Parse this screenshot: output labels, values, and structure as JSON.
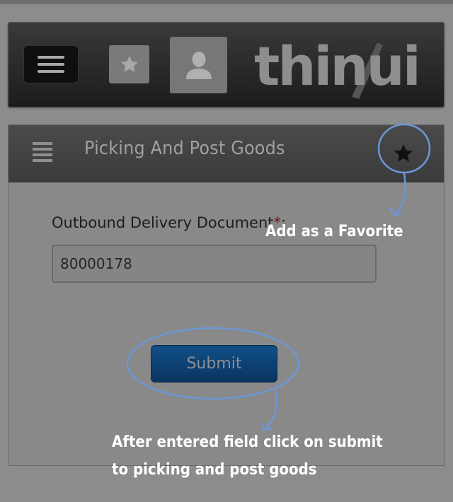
{
  "header": {
    "menu_icon": "menu-icon",
    "favorites_icon": "star-icon",
    "user_icon": "user-icon",
    "logo_text": "thinui"
  },
  "panel": {
    "menu_icon": "hamburger-icon",
    "title": "Picking And Post Goods",
    "favorite_icon": "star-icon"
  },
  "form": {
    "field_label": "Outbound Delivery Document",
    "required_marker": "*",
    "label_suffix": ":",
    "field_value": "80000178",
    "submit_label": "Submit"
  },
  "annotations": {
    "favorite_note": "Add as a Favorite",
    "submit_note_line1": "After entered field click on submit",
    "submit_note_line2": "to picking and post goods"
  },
  "colors": {
    "annotation_stroke": "#6b97d6",
    "submit_button": "#0a3f70"
  }
}
